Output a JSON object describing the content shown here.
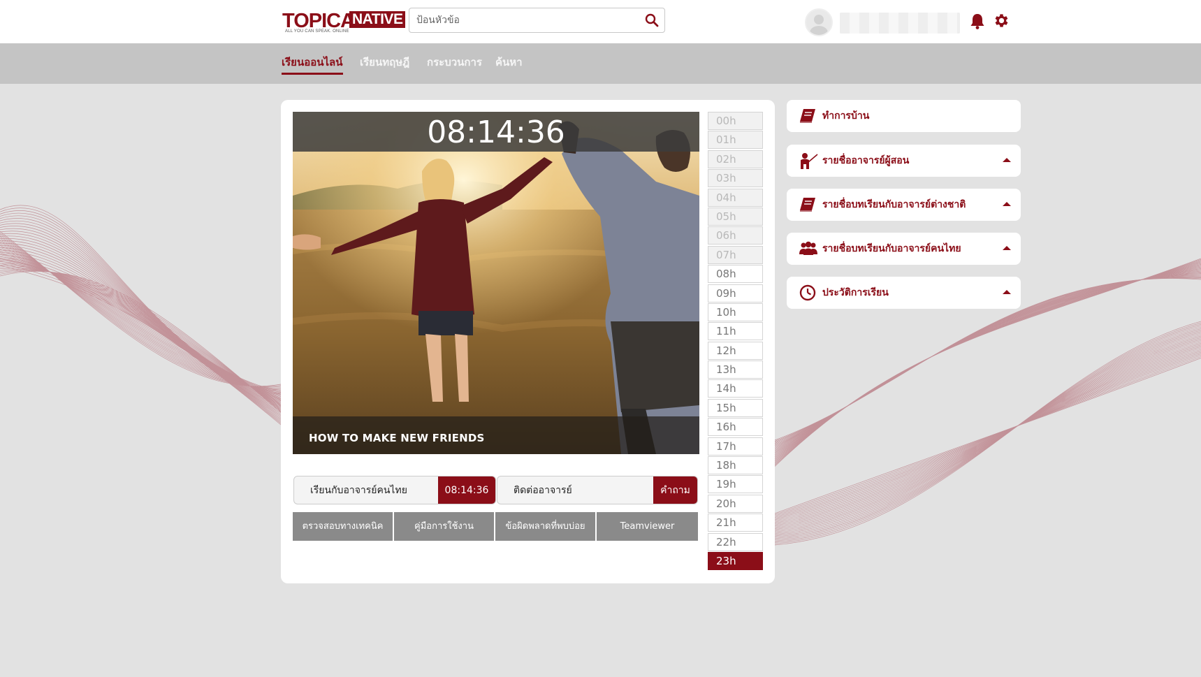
{
  "brand": {
    "logo_main": "TOPICA",
    "logo_sub": "NATIVE",
    "logo_tagline": "ALL YOU CAN SPEAK. ONLINE",
    "accent_color": "#8b0e18"
  },
  "search": {
    "placeholder": "ป้อนหัวข้อ",
    "icon": "search-icon"
  },
  "user": {
    "avatar_icon": "user-avatar-icon",
    "notification_icon": "bell-icon",
    "settings_icon": "gear-icon"
  },
  "nav": {
    "items": [
      {
        "label": "เรียนออนไลน์",
        "active": true
      },
      {
        "label": "เรียนทฤษฎี",
        "active": false
      },
      {
        "label": "กระบวนการ",
        "active": false
      },
      {
        "label": "ค้นหา",
        "active": false
      }
    ]
  },
  "video": {
    "clock": "08:14:36",
    "caption": "HOW TO MAKE NEW FRIENDS"
  },
  "actions": {
    "thai_teacher_label": "เรียนกับอาจารย์คนไทย",
    "thai_teacher_time": "08:14:36",
    "contact_label": "ติดต่ออาจารย์",
    "contact_action": "คำถาม"
  },
  "support_buttons": [
    "ตรวจสอบทางเทคนิค",
    "คู่มือการใช้งาน",
    "ข้อผิดพลาดที่พบบ่อย",
    "Teamviewer"
  ],
  "hours": [
    {
      "label": "00h",
      "state": "past"
    },
    {
      "label": "01h",
      "state": "past"
    },
    {
      "label": "02h",
      "state": "past"
    },
    {
      "label": "03h",
      "state": "past"
    },
    {
      "label": "04h",
      "state": "past"
    },
    {
      "label": "05h",
      "state": "past"
    },
    {
      "label": "06h",
      "state": "past"
    },
    {
      "label": "07h",
      "state": "past"
    },
    {
      "label": "08h",
      "state": "normal"
    },
    {
      "label": "09h",
      "state": "normal"
    },
    {
      "label": "10h",
      "state": "normal"
    },
    {
      "label": "11h",
      "state": "normal"
    },
    {
      "label": "12h",
      "state": "normal"
    },
    {
      "label": "13h",
      "state": "normal"
    },
    {
      "label": "14h",
      "state": "normal"
    },
    {
      "label": "15h",
      "state": "normal"
    },
    {
      "label": "16h",
      "state": "normal"
    },
    {
      "label": "17h",
      "state": "normal"
    },
    {
      "label": "18h",
      "state": "normal"
    },
    {
      "label": "19h",
      "state": "normal"
    },
    {
      "label": "20h",
      "state": "normal"
    },
    {
      "label": "21h",
      "state": "normal"
    },
    {
      "label": "22h",
      "state": "normal"
    },
    {
      "label": "23h",
      "state": "current"
    }
  ],
  "panels": [
    {
      "title": "ทำการบ้าน",
      "icon": "book-icon",
      "collapsible": false
    },
    {
      "title": "รายชื่ออาจารย์ผู้สอน",
      "icon": "teacher-icon",
      "collapsible": true
    },
    {
      "title": "รายชื่อบทเรียนกับอาจารย์ต่างชาติ",
      "icon": "book-icon",
      "collapsible": true
    },
    {
      "title": "รายชื่อบทเรียนกับอาจารย์คนไทย",
      "icon": "users-icon",
      "collapsible": true
    },
    {
      "title": "ประวัติการเรียน",
      "icon": "clock-icon",
      "collapsible": true
    }
  ]
}
